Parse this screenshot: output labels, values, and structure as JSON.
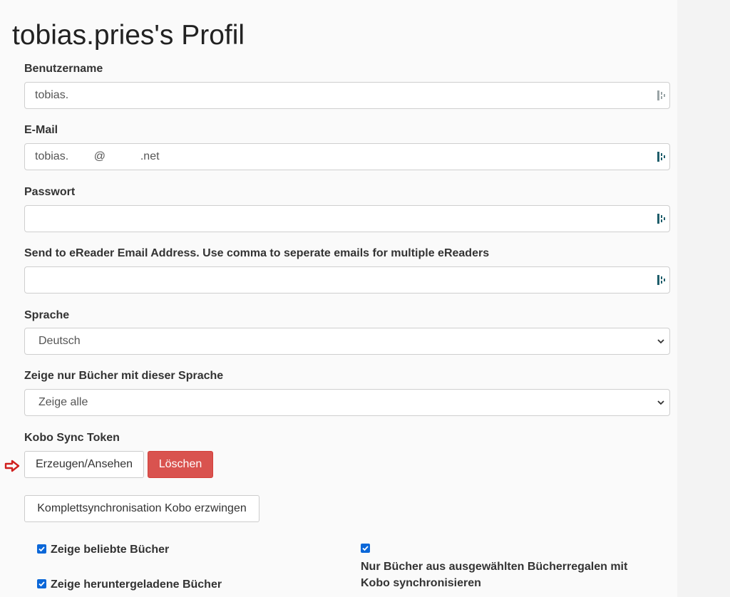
{
  "page": {
    "title": "tobias.pries's Profil"
  },
  "fields": {
    "username": {
      "label": "Benutzername",
      "value": "tobias."
    },
    "email": {
      "label": "E-Mail",
      "value": "tobias.        @           .net"
    },
    "password": {
      "label": "Passwort",
      "value": ""
    },
    "ereader": {
      "label": "Send to eReader Email Address. Use comma to seperate emails for multiple eReaders",
      "value": ""
    },
    "language": {
      "label": "Sprache",
      "value": "Deutsch"
    },
    "book_language": {
      "label": "Zeige nur Bücher mit dieser Sprache",
      "value": "Zeige alle"
    }
  },
  "kobo": {
    "label": "Kobo Sync Token",
    "generate_button": "Erzeugen/Ansehen",
    "delete_button": "Löschen",
    "full_sync_button": "Komplettsynchronisation Kobo erzwingen"
  },
  "checkboxes": {
    "popular": {
      "label": "Zeige beliebte Bücher",
      "checked": true
    },
    "downloaded": {
      "label": "Zeige heruntergeladene Bücher",
      "checked": true
    },
    "shelves_sync": {
      "label_line1": "Nur Bücher aus ausgewählten Bücherregalen mit",
      "label_line2": "Kobo synchronisieren",
      "checked": true
    }
  },
  "colors": {
    "danger": "#d9534f",
    "checkbox": "#0b67d8",
    "password_manager_icon": "#1f5e6b",
    "arrow": "#d0201e"
  },
  "icons": {
    "field_icon": "password-manager-icon",
    "select_icon": "chevron-down-icon",
    "pointer": "arrow-right-icon"
  }
}
